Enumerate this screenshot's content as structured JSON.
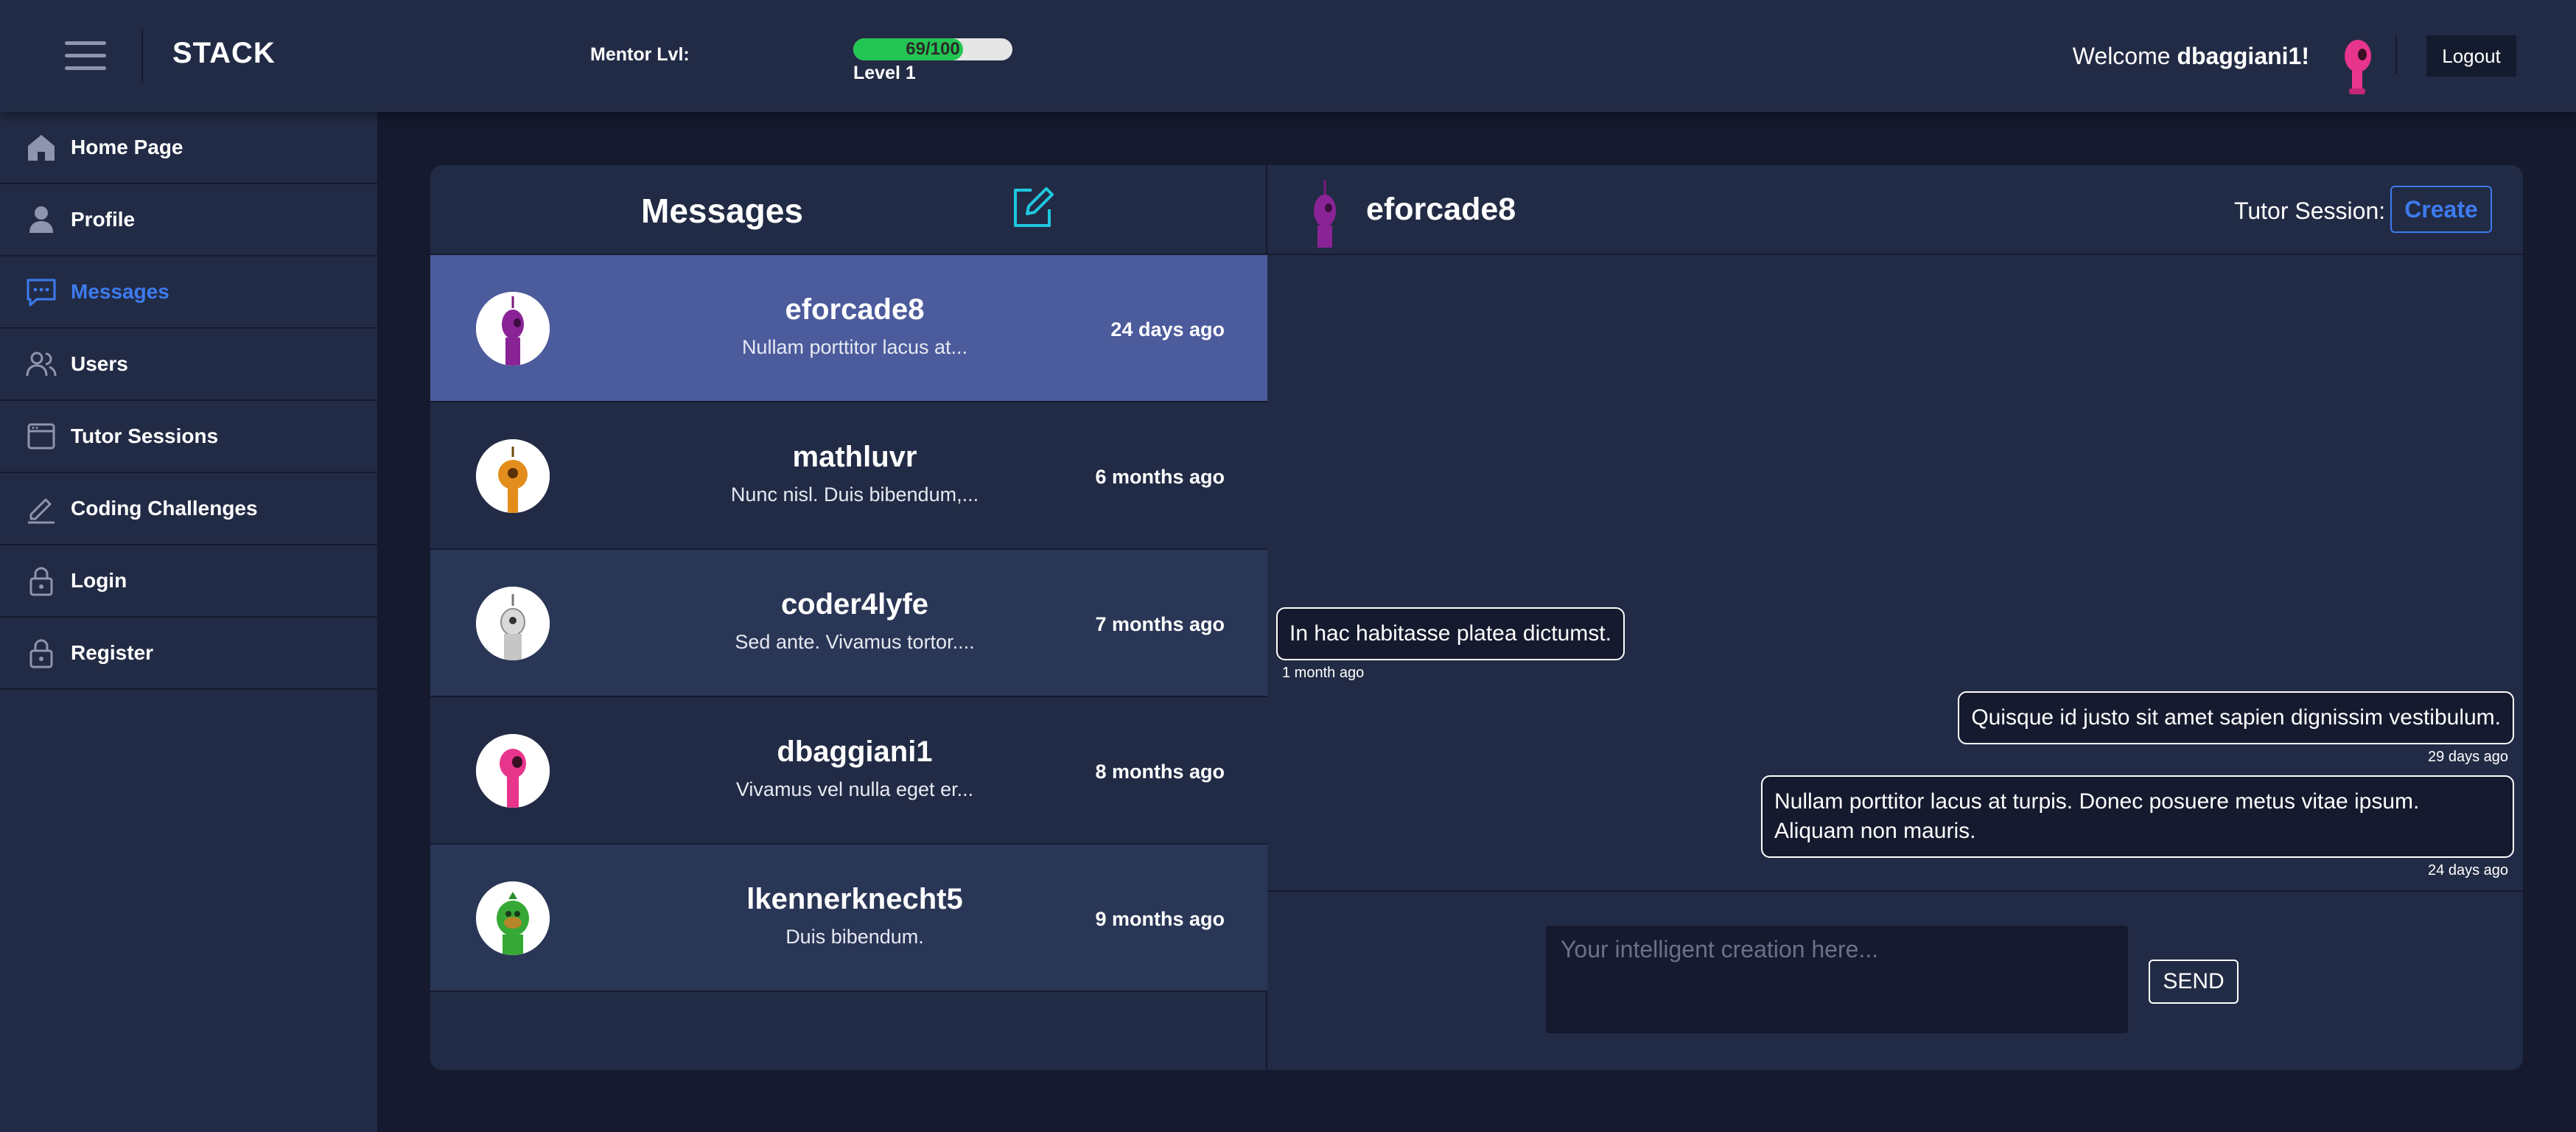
{
  "brand": "STACK",
  "mentor": {
    "label": "Mentor Lvl:",
    "progress_text": "69/100",
    "progress_value": 69,
    "progress_max": 100,
    "level": "Level 1"
  },
  "user": {
    "welcome": "Welcome",
    "username": "dbaggiani1!",
    "logout": "Logout"
  },
  "sidebar": {
    "items": [
      {
        "label": "Home Page",
        "icon": "home-icon",
        "active": false
      },
      {
        "label": "Profile",
        "icon": "person-icon",
        "active": false
      },
      {
        "label": "Messages",
        "icon": "chat-icon",
        "active": true
      },
      {
        "label": "Users",
        "icon": "users-icon",
        "active": false
      },
      {
        "label": "Tutor Sessions",
        "icon": "calendar-window-icon",
        "active": false
      },
      {
        "label": "Coding Challenges",
        "icon": "pencil-icon",
        "active": false
      },
      {
        "label": "Login",
        "icon": "lock-icon",
        "active": false
      },
      {
        "label": "Register",
        "icon": "lock-icon",
        "active": false
      }
    ]
  },
  "messages": {
    "title": "Messages",
    "conversations": [
      {
        "name": "eforcade8",
        "preview": "Nullam porttitor lacus at...",
        "time": "24 days ago",
        "selected": true
      },
      {
        "name": "mathluvr",
        "preview": "Nunc nisl. Duis bibendum,...",
        "time": "6 months ago",
        "selected": false
      },
      {
        "name": "coder4lyfe",
        "preview": "Sed ante. Vivamus tortor....",
        "time": "7 months ago",
        "selected": false
      },
      {
        "name": "dbaggiani1",
        "preview": "Vivamus vel nulla eget er...",
        "time": "8 months ago",
        "selected": false
      },
      {
        "name": "lkennerknecht5",
        "preview": "Duis bibendum.",
        "time": "9 months ago",
        "selected": false
      }
    ]
  },
  "chat": {
    "recipient": "eforcade8",
    "tutor_label": "Tutor Session:",
    "create_label": "Create",
    "messages": [
      {
        "text": "In hac habitasse platea dictumst.",
        "time": "1 month ago",
        "side": "left"
      },
      {
        "text": "Quisque id justo sit amet sapien dignissim vestibulum.",
        "time": "29 days ago",
        "side": "right"
      },
      {
        "text": "Nullam porttitor lacus at turpis. Donec posuere metus vitae ipsum. Aliquam non mauris.",
        "time": "24 days ago",
        "side": "right"
      }
    ],
    "input_placeholder": "Your intelligent creation here...",
    "input_value": "",
    "send_label": "SEND"
  },
  "colors": {
    "accent": "#3d7bf0",
    "selected_row": "#4b5b9c",
    "alt_row": "#2a3656",
    "progress": "#23c552",
    "compose_icon": "#1ec8e0"
  }
}
